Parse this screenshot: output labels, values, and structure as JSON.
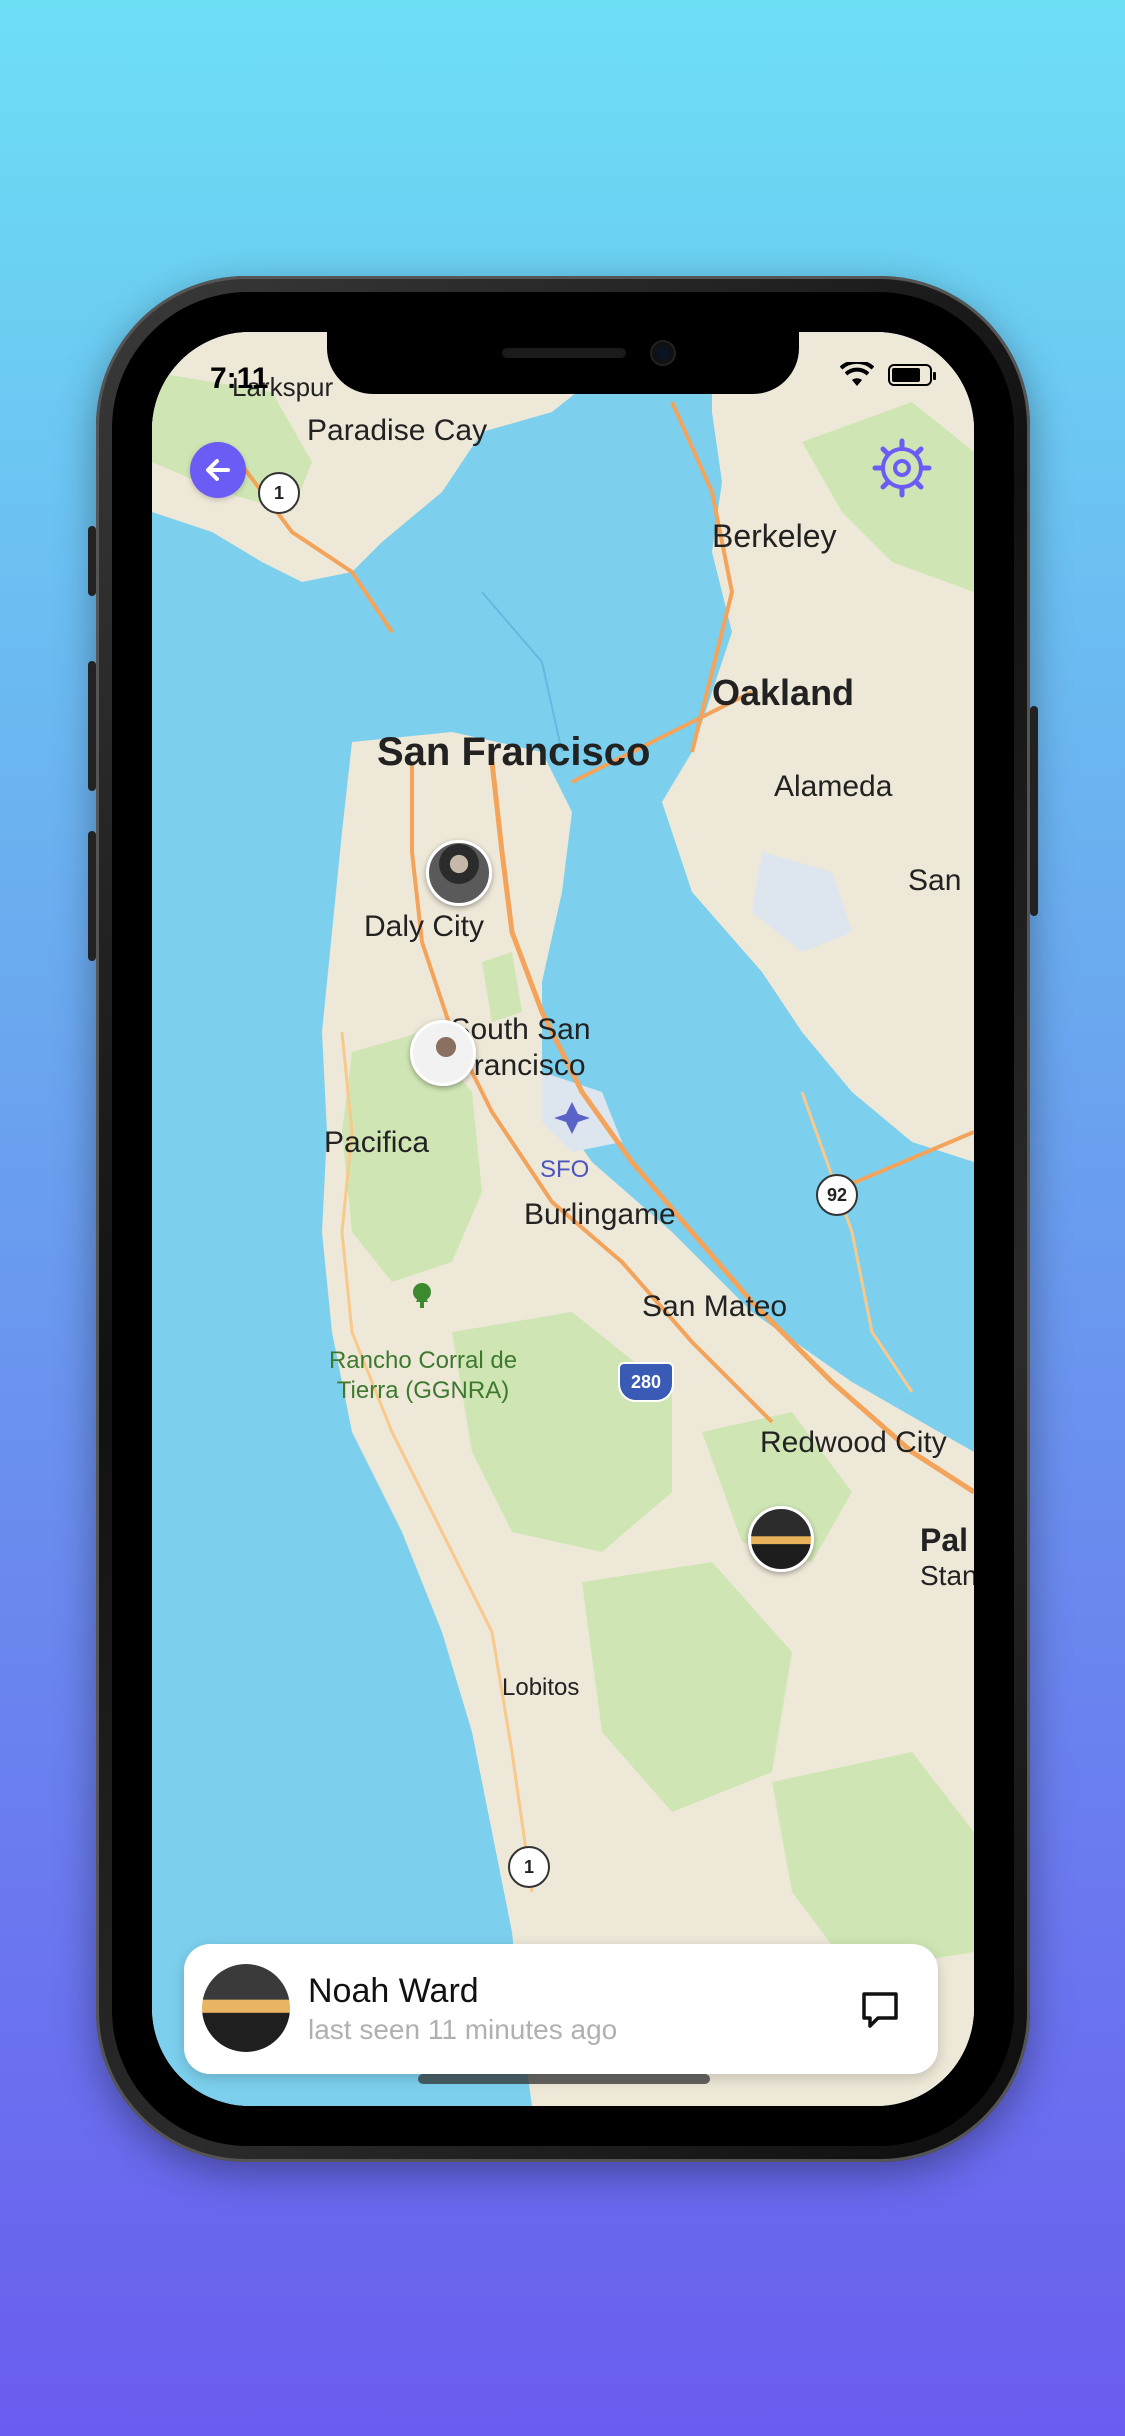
{
  "status_bar": {
    "time": "7:11"
  },
  "map": {
    "places": [
      {
        "name": "Larkspur"
      },
      {
        "name": "Paradise Cay"
      },
      {
        "name": "Berkeley"
      },
      {
        "name": "Oakland"
      },
      {
        "name": "San Francisco"
      },
      {
        "name": "Alameda"
      },
      {
        "name": "San"
      },
      {
        "name": "Daly City"
      },
      {
        "name": "South San Francisco"
      },
      {
        "name": "Pacifica"
      },
      {
        "name": "SFO"
      },
      {
        "name": "Burlingame"
      },
      {
        "name": "San Mateo"
      },
      {
        "name": "Rancho Corral de Tierra (GGNRA)"
      },
      {
        "name": "Redwood City"
      },
      {
        "name": "Pal"
      },
      {
        "name": "Stan"
      },
      {
        "name": "Lobitos"
      }
    ],
    "route_shields": [
      "1",
      "92",
      "280",
      "1"
    ]
  },
  "contact_card": {
    "name": "Noah Ward",
    "last_seen": "last seen 11 minutes ago"
  },
  "colors": {
    "accent": "#6b5cf5",
    "water": "#7cd0ee",
    "land": "#f1ede4",
    "park": "#cfe6b4"
  }
}
